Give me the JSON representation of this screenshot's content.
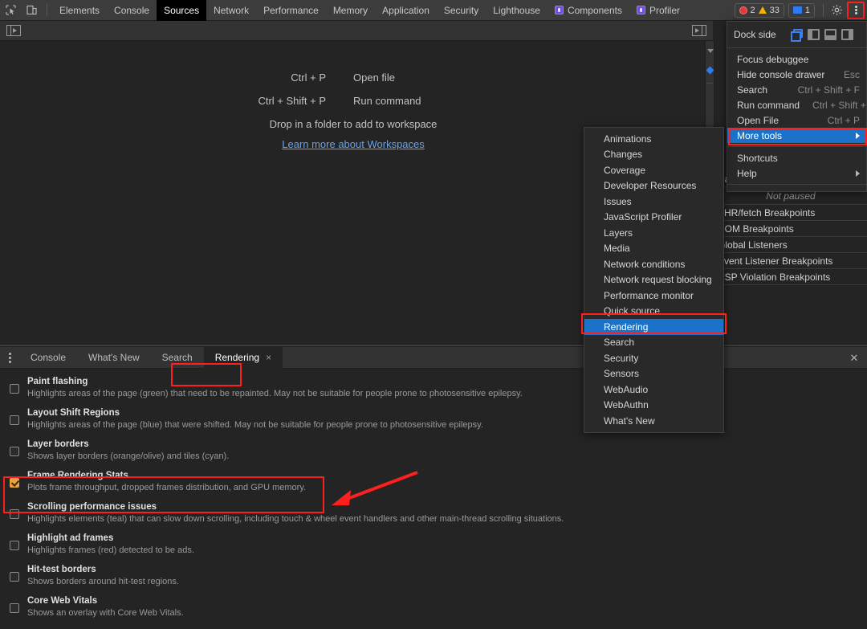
{
  "main_tabs": [
    {
      "label": "Elements",
      "active": false,
      "icon": null
    },
    {
      "label": "Console",
      "active": false,
      "icon": null
    },
    {
      "label": "Sources",
      "active": true,
      "icon": null
    },
    {
      "label": "Network",
      "active": false,
      "icon": null
    },
    {
      "label": "Performance",
      "active": false,
      "icon": null
    },
    {
      "label": "Memory",
      "active": false,
      "icon": null
    },
    {
      "label": "Application",
      "active": false,
      "icon": null
    },
    {
      "label": "Security",
      "active": false,
      "icon": null
    },
    {
      "label": "Lighthouse",
      "active": false,
      "icon": null
    },
    {
      "label": "Components",
      "active": false,
      "icon": "react-logo-icon"
    },
    {
      "label": "Profiler",
      "active": false,
      "icon": "react-logo-icon"
    }
  ],
  "status_badges": {
    "error_count": "2",
    "warning_count": "33",
    "message_count": "1"
  },
  "toolbar_icons": {
    "inspect": "inspect-element-icon",
    "device": "device-toolbar-icon",
    "settings": "gear-icon",
    "more": "kebab-menu-icon"
  },
  "sources_panel": {
    "hints": [
      {
        "key": "Ctrl + P",
        "action": "Open file"
      },
      {
        "key": "Ctrl + Shift + P",
        "action": "Run command"
      }
    ],
    "drop_hint": "Drop in a folder to add to workspace",
    "link": "Learn more about Workspaces"
  },
  "debugger_sidebar": {
    "call_stack_label": "Call Stack",
    "not_paused": "Not paused",
    "sections": [
      "XHR/fetch Breakpoints",
      "DOM Breakpoints",
      "Global Listeners",
      "Event Listener Breakpoints",
      "CSP Violation Breakpoints"
    ]
  },
  "main_menu": {
    "dock_side_label": "Dock side",
    "dock_options": [
      {
        "name": "undock-into-separate-window",
        "selected": true
      },
      {
        "name": "dock-to-left",
        "selected": false
      },
      {
        "name": "dock-to-bottom",
        "selected": false
      },
      {
        "name": "dock-to-right",
        "selected": false
      }
    ],
    "items": [
      {
        "label": "Focus debuggee",
        "shortcut": "",
        "arrow": false,
        "selected": false
      },
      {
        "label": "Hide console drawer",
        "shortcut": "Esc",
        "arrow": false,
        "selected": false
      },
      {
        "label": "Search",
        "shortcut": "Ctrl + Shift + F",
        "arrow": false,
        "selected": false
      },
      {
        "label": "Run command",
        "shortcut": "Ctrl + Shift + P",
        "arrow": false,
        "selected": false
      },
      {
        "label": "Open File",
        "shortcut": "Ctrl + P",
        "arrow": false,
        "selected": false
      },
      {
        "label": "More tools",
        "shortcut": "",
        "arrow": true,
        "selected": true
      }
    ],
    "items_after": [
      {
        "label": "Shortcuts",
        "shortcut": "",
        "arrow": false,
        "selected": false
      },
      {
        "label": "Help",
        "shortcut": "",
        "arrow": true,
        "selected": false
      }
    ]
  },
  "more_tools_submenu": {
    "items": [
      {
        "label": "Animations",
        "selected": false
      },
      {
        "label": "Changes",
        "selected": false
      },
      {
        "label": "Coverage",
        "selected": false
      },
      {
        "label": "Developer Resources",
        "selected": false
      },
      {
        "label": "Issues",
        "selected": false
      },
      {
        "label": "JavaScript Profiler",
        "selected": false
      },
      {
        "label": "Layers",
        "selected": false
      },
      {
        "label": "Media",
        "selected": false
      },
      {
        "label": "Network conditions",
        "selected": false
      },
      {
        "label": "Network request blocking",
        "selected": false
      },
      {
        "label": "Performance monitor",
        "selected": false
      },
      {
        "label": "Quick source",
        "selected": false
      },
      {
        "label": "Rendering",
        "selected": true
      },
      {
        "label": "Search",
        "selected": false
      },
      {
        "label": "Security",
        "selected": false
      },
      {
        "label": "Sensors",
        "selected": false
      },
      {
        "label": "WebAudio",
        "selected": false
      },
      {
        "label": "WebAuthn",
        "selected": false
      },
      {
        "label": "What's New",
        "selected": false
      }
    ]
  },
  "drawer": {
    "tabs": [
      {
        "label": "Console",
        "active": false,
        "closable": false
      },
      {
        "label": "What's New",
        "active": false,
        "closable": false
      },
      {
        "label": "Search",
        "active": false,
        "closable": false
      },
      {
        "label": "Rendering",
        "active": true,
        "closable": true
      }
    ],
    "close_label": "✕",
    "rendering_options": [
      {
        "title": "Paint flashing",
        "desc": "Highlights areas of the page (green) that need to be repainted. May not be suitable for people prone to photosensitive epilepsy.",
        "checked": false
      },
      {
        "title": "Layout Shift Regions",
        "desc": "Highlights areas of the page (blue) that were shifted. May not be suitable for people prone to photosensitive epilepsy.",
        "checked": false
      },
      {
        "title": "Layer borders",
        "desc": "Shows layer borders (orange/olive) and tiles (cyan).",
        "checked": false
      },
      {
        "title": "Frame Rendering Stats",
        "desc": "Plots frame throughput, dropped frames distribution, and GPU memory.",
        "checked": true
      },
      {
        "title": "Scrolling performance issues",
        "desc": "Highlights elements (teal) that can slow down scrolling, including touch & wheel event handlers and other main-thread scrolling situations.",
        "checked": false
      },
      {
        "title": "Highlight ad frames",
        "desc": "Highlights frames (red) detected to be ads.",
        "checked": false
      },
      {
        "title": "Hit-test borders",
        "desc": "Shows borders around hit-test regions.",
        "checked": false
      },
      {
        "title": "Core Web Vitals",
        "desc": "Shows an overlay with Core Web Vitals.",
        "checked": false
      }
    ]
  },
  "annotations": {
    "highlight_color": "#ff1f1f",
    "arrow_color": "#ff1f1f"
  }
}
